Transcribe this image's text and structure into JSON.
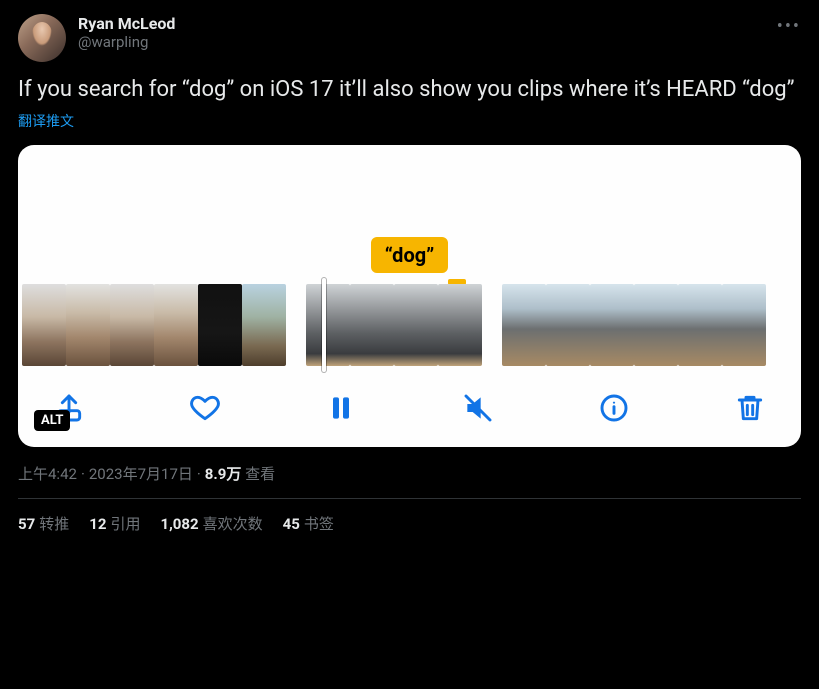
{
  "author": {
    "display_name": "Ryan McLeod",
    "handle": "@warpling"
  },
  "more_icon_label": "more-options",
  "body_text": "If you search for “dog” on iOS 17 it’ll also show you clips where it’s HEARD “dog”",
  "translate_label": "翻译推文",
  "media": {
    "search_tag": "“dog”",
    "alt_badge": "ALT",
    "toolbar_icons": [
      "share",
      "heart",
      "pause",
      "mute",
      "info",
      "trash"
    ]
  },
  "meta": {
    "time": "上午4:42",
    "date": "2023年7月17日",
    "views_value": "8.9万",
    "views_label": "查看"
  },
  "stats": {
    "retweets": {
      "value": "57",
      "label": "转推"
    },
    "quotes": {
      "value": "12",
      "label": "引用"
    },
    "likes": {
      "value": "1,082",
      "label": "喜欢次数"
    },
    "bookmarks": {
      "value": "45",
      "label": "书签"
    }
  }
}
